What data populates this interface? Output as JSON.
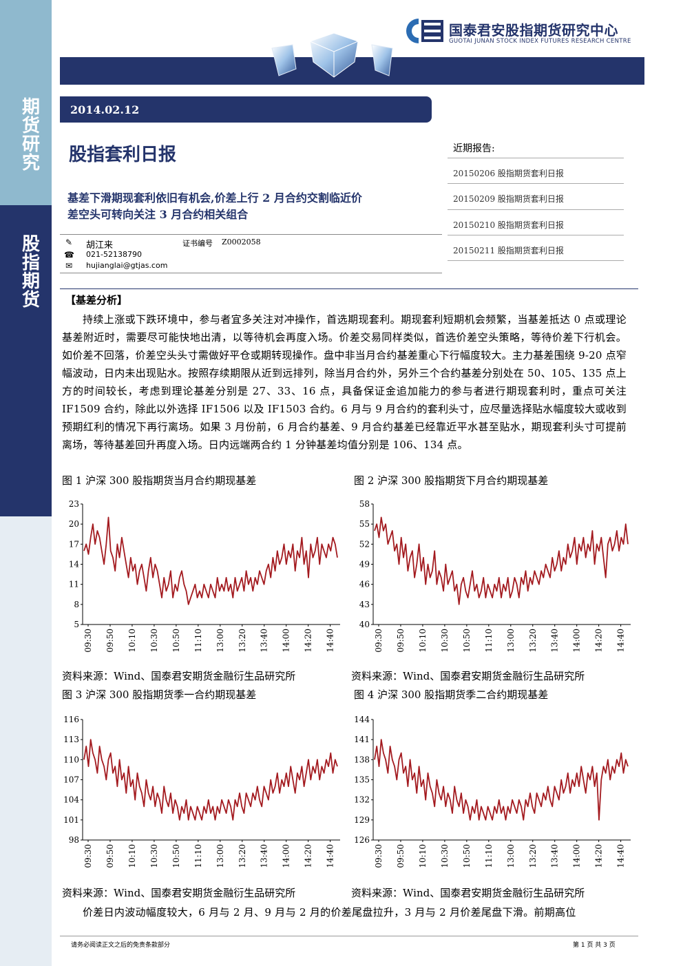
{
  "sidebar": {
    "top_label": [
      "期",
      "货",
      "研",
      "究"
    ],
    "mid_label": [
      "股",
      "指",
      "期",
      "货"
    ]
  },
  "header": {
    "org_cn": "国泰君安股指期货研究中心",
    "org_en": "GUOTAI JUNAN STOCK INDEX FUTURES RESEARCH CENTRE"
  },
  "report": {
    "date": "2014.02.12",
    "title": "股指套利日报",
    "headline_1": "基差下滑期现套利依旧有机会,价差上行 2 月合约交割临近价",
    "headline_2": "差空头可转向关注 3 月合约相关组合"
  },
  "author": {
    "name": "胡江来",
    "cert_label": "证书编号",
    "cert_no": "Z0002058",
    "phone": "021-52138790",
    "email": "hujianglai@gtjas.com"
  },
  "recent": {
    "heading": "近期报告:",
    "items": [
      "20150206 股指期货套利日报",
      "20150209 股指期货套利日报",
      "20150210 股指期货套利日报",
      "20150211 股指期货套利日报"
    ]
  },
  "section": {
    "title": "【基差分析】",
    "body": "持续上涨或下跌环境中，参与者宜多关注对冲操作，首选期现套利。期现套利短期机会频繁，当基差抵达 0 点或理论基差附近时，需要尽可能快地出清，以等待机会再度入场。价差交易同样类似，首选价差空头策略，等待价差下行机会。如价差不回落，价差空头头寸需做好平仓或期转现操作。盘中非当月合约基差重心下行幅度较大。主力基差围绕 9-20 点窄幅波动，日内未出现贴水。按照存续期限从近到远排列，除当月合约外，另外三个合约基差分别处在 50、105、135 点上方的时间较长，考虑到理论基差分别是 27、33、16 点，具备保证金追加能力的参与者进行期现套利时，重点可关注 IF1509 合约，除此以外选择 IF1506 以及 IF1503 合约。6 月与 9 月合约的套利头寸，应尽量选择贴水幅度较大或收到预期红利的情况下再行离场。如果 3 月份前，6 月合约基差、9 月合约基差已经靠近平水甚至贴水，期现套利头寸可提前离场，等待基差回升再度入场。日内远端两合约 1 分钟基差均值分别是 106、134 点。",
    "body2": "价差日内波动幅度较大，6 月与 2 月、9 月与 2 月的价差尾盘拉升，3 月与 2 月价差尾盘下滑。前期高位"
  },
  "figures": {
    "source": "资料来源：Wind、国泰君安期货金融衍生品研究所",
    "titles": [
      "图 1 沪深 300 股指期货当月合约期现基差",
      "图 2 沪深 300 股指期货下月合约期现基差",
      "图 3 沪深 300 股指期货季一合约期现基差",
      "图 4 沪深 300 股指期货季二合约期现基差"
    ]
  },
  "chart_data": [
    {
      "type": "line",
      "title": "图 1 沪深 300 股指期货当月合约期现基差",
      "ylim": [
        5,
        23
      ],
      "yticks": [
        5,
        8,
        11,
        14,
        17,
        20,
        23
      ],
      "categories": [
        "09:30",
        "09:50",
        "10:10",
        "10:30",
        "10:50",
        "11:10",
        "13:00",
        "13:20",
        "13:40",
        "14:00",
        "14:20",
        "14:40"
      ],
      "color": "#a31a1f",
      "series": [
        {
          "values": [
            16,
            17,
            15.5,
            18,
            20,
            17,
            19,
            18,
            16,
            14,
            17,
            21,
            16,
            15,
            13,
            17,
            15,
            18,
            16,
            14,
            12,
            15,
            13,
            14,
            11,
            13,
            14,
            12,
            10,
            13,
            15,
            12,
            14,
            13,
            11,
            9,
            12,
            10,
            11,
            13,
            9,
            11,
            10,
            12,
            13,
            11,
            10,
            8,
            9,
            10,
            11,
            9,
            10,
            9,
            11,
            10,
            9,
            11,
            10,
            9,
            12,
            10,
            11,
            10,
            12,
            10,
            11,
            9,
            12,
            10,
            11,
            12,
            10,
            13,
            11,
            12,
            10,
            12,
            11,
            13,
            12,
            11,
            13,
            14,
            12,
            15,
            13,
            16,
            14,
            15,
            17,
            14,
            16,
            15,
            17,
            13,
            16,
            15,
            18,
            14,
            16,
            12,
            17,
            15,
            16,
            18,
            14,
            17,
            16,
            15,
            17,
            16,
            18,
            17,
            15
          ]
        }
      ]
    },
    {
      "type": "line",
      "title": "图 2 沪深 300 股指期货下月合约期现基差",
      "ylim": [
        40,
        58
      ],
      "yticks": [
        40,
        43,
        46,
        49,
        52,
        55,
        58
      ],
      "categories": [
        "09:30",
        "09:50",
        "10:10",
        "10:30",
        "10:50",
        "11:10",
        "13:00",
        "13:20",
        "13:40",
        "14:00",
        "14:20",
        "14:40"
      ],
      "color": "#a31a1f",
      "series": [
        {
          "values": [
            54,
            55,
            53,
            56,
            54,
            55,
            52,
            53,
            54,
            51,
            52,
            49,
            53,
            50,
            52,
            48,
            50,
            51,
            47,
            49,
            52,
            48,
            50,
            46,
            49,
            47,
            48,
            51,
            46,
            48,
            47,
            45,
            49,
            46,
            47,
            48,
            45,
            46,
            43,
            46,
            47,
            45,
            44,
            46,
            48,
            45,
            46,
            44,
            45,
            47,
            44,
            46,
            45,
            44,
            46,
            45,
            47,
            44,
            46,
            45,
            47,
            44,
            45,
            47,
            46,
            44,
            47,
            46,
            48,
            45,
            47,
            46,
            48,
            47,
            46,
            48,
            47,
            49,
            48,
            47,
            50,
            48,
            49,
            51,
            48,
            50,
            49,
            52,
            50,
            51,
            53,
            49,
            52,
            51,
            53,
            50,
            52,
            51,
            54,
            49,
            52,
            51,
            53,
            50,
            47,
            52,
            53,
            51,
            52,
            54,
            51,
            53,
            52,
            55,
            52
          ]
        }
      ]
    },
    {
      "type": "line",
      "title": "图 3 沪深 300 股指期货季一合约期现基差",
      "ylim": [
        98,
        116
      ],
      "yticks": [
        98,
        101,
        104,
        107,
        110,
        113,
        116
      ],
      "categories": [
        "09:30",
        "09:50",
        "10:10",
        "10:30",
        "10:50",
        "11:10",
        "13:00",
        "13:20",
        "13:40",
        "14:00",
        "14:20",
        "14:40"
      ],
      "color": "#a31a1f",
      "series": [
        {
          "values": [
            110,
            112,
            109,
            113,
            111,
            110,
            108,
            112,
            110,
            109,
            107,
            110,
            111,
            108,
            109,
            106,
            110,
            107,
            108,
            105,
            109,
            106,
            107,
            104,
            108,
            106,
            105,
            103,
            107,
            105,
            104,
            106,
            103,
            105,
            104,
            102,
            106,
            104,
            103,
            105,
            102,
            104,
            103,
            101,
            103,
            102,
            104,
            101,
            103,
            102,
            101,
            103,
            102,
            101,
            103,
            102,
            104,
            102,
            103,
            101,
            103,
            102,
            104,
            103,
            102,
            104,
            103,
            101,
            104,
            103,
            105,
            103,
            102,
            105,
            104,
            103,
            105,
            104,
            106,
            104,
            103,
            106,
            105,
            104,
            107,
            105,
            106,
            108,
            105,
            107,
            106,
            108,
            106,
            109,
            107,
            105,
            108,
            107,
            109,
            106,
            108,
            110,
            107,
            109,
            108,
            110,
            107,
            109,
            108,
            110,
            109,
            111,
            108,
            110,
            109
          ]
        }
      ]
    },
    {
      "type": "line",
      "title": "图 4 沪深 300 股指期货季二合约期现基差",
      "ylim": [
        126,
        144
      ],
      "yticks": [
        126,
        129,
        132,
        135,
        138,
        141,
        144
      ],
      "categories": [
        "09:30",
        "09:50",
        "10:10",
        "10:30",
        "10:50",
        "11:10",
        "13:00",
        "13:20",
        "13:40",
        "14:00",
        "14:20",
        "14:40"
      ],
      "color": "#a31a1f",
      "series": [
        {
          "values": [
            138,
            140,
            137,
            141,
            139,
            138,
            136,
            140,
            138,
            137,
            135,
            138,
            139,
            136,
            137,
            134,
            138,
            135,
            136,
            133,
            137,
            134,
            135,
            132,
            136,
            134,
            133,
            131,
            135,
            133,
            132,
            134,
            131,
            133,
            132,
            130,
            134,
            132,
            131,
            133,
            130,
            132,
            131,
            129,
            131,
            130,
            132,
            129,
            131,
            130,
            129,
            131,
            130,
            129,
            131,
            130,
            132,
            130,
            131,
            129,
            131,
            130,
            132,
            131,
            130,
            132,
            131,
            129,
            132,
            131,
            133,
            131,
            130,
            133,
            132,
            131,
            133,
            132,
            134,
            132,
            131,
            134,
            133,
            132,
            135,
            133,
            134,
            136,
            133,
            135,
            134,
            136,
            134,
            137,
            135,
            133,
            136,
            135,
            137,
            134,
            136,
            129,
            135,
            137,
            136,
            138,
            135,
            137,
            136,
            138,
            137,
            139,
            136,
            138,
            137
          ]
        }
      ]
    }
  ],
  "footer": {
    "disclaimer": "请务必阅读正文之后的免责条款部分",
    "page": "第 1 页 共 3 页"
  },
  "colors": {
    "navy": "#24346b",
    "sidebar_light": "#8fb9ce",
    "series_red": "#a31a1f"
  }
}
